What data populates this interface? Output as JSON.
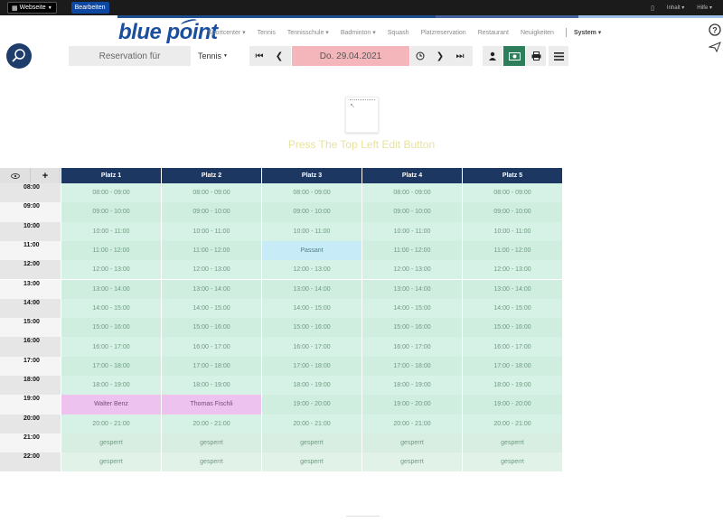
{
  "adminbar": {
    "website_label": "Webseite",
    "edit_label": "Bearbeiten",
    "content_label": "Inhalt",
    "help_label": "Hilfe"
  },
  "progress_colors": [
    "#1f4e8c",
    "#43649c",
    "#9bc2e6"
  ],
  "brand": {
    "logo_text": "blue point",
    "color": "#1a4f9e"
  },
  "nav": {
    "items": [
      {
        "label": "Sportcenter",
        "dropdown": true
      },
      {
        "label": "Tennis",
        "dropdown": false
      },
      {
        "label": "Tennisschule",
        "dropdown": true
      },
      {
        "label": "Badminton",
        "dropdown": true
      },
      {
        "label": "Squash",
        "dropdown": false
      },
      {
        "label": "Platzreservation",
        "dropdown": false
      },
      {
        "label": "Restaurant",
        "dropdown": false
      },
      {
        "label": "Neuigkeiten",
        "dropdown": false
      }
    ],
    "system_label": "System"
  },
  "toolbar": {
    "reservation_label": "Reservation für",
    "sport_select": "Tennis",
    "date": "Do. 29.04.2021"
  },
  "edit_hint": "Press The Top Left Edit Button",
  "grid": {
    "courts": [
      "Platz 1",
      "Platz 2",
      "Platz 3",
      "Platz 4",
      "Platz 5"
    ],
    "times": [
      "08:00",
      "09:00",
      "10:00",
      "11:00",
      "12:00",
      "13:00",
      "14:00",
      "15:00",
      "16:00",
      "17:00",
      "18:00",
      "19:00",
      "20:00",
      "21:00",
      "22:00"
    ],
    "rows": [
      [
        "08:00 - 09:00",
        "08:00 - 09:00",
        "08:00 - 09:00",
        "08:00 - 09:00",
        "08:00 - 09:00"
      ],
      [
        "09:00 - 10:00",
        "09:00 - 10:00",
        "09:00 - 10:00",
        "09:00 - 10:00",
        "09:00 - 10:00"
      ],
      [
        "10:00 - 11:00",
        "10:00 - 11:00",
        "10:00 - 11:00",
        "10:00 - 11:00",
        "10:00 - 11:00"
      ],
      [
        "11:00 - 12:00",
        "11:00 - 12:00",
        "Passant",
        "11:00 - 12:00",
        "11:00 - 12:00"
      ],
      [
        "12:00 - 13:00",
        "12:00 - 13:00",
        "12:00 - 13:00",
        "12:00 - 13:00",
        "12:00 - 13:00"
      ],
      [
        "13:00 - 14:00",
        "13:00 - 14:00",
        "13:00 - 14:00",
        "13:00 - 14:00",
        "13:00 - 14:00"
      ],
      [
        "14:00 - 15:00",
        "14:00 - 15:00",
        "14:00 - 15:00",
        "14:00 - 15:00",
        "14:00 - 15:00"
      ],
      [
        "15:00 - 16:00",
        "15:00 - 16:00",
        "15:00 - 16:00",
        "15:00 - 16:00",
        "15:00 - 16:00"
      ],
      [
        "16:00 - 17:00",
        "16:00 - 17:00",
        "16:00 - 17:00",
        "16:00 - 17:00",
        "16:00 - 17:00"
      ],
      [
        "17:00 - 18:00",
        "17:00 - 18:00",
        "17:00 - 18:00",
        "17:00 - 18:00",
        "17:00 - 18:00"
      ],
      [
        "18:00 - 19:00",
        "18:00 - 19:00",
        "18:00 - 19:00",
        "18:00 - 19:00",
        "18:00 - 19:00"
      ],
      [
        "Walter Benz",
        "Thomas Fischli",
        "19:00 - 20:00",
        "19:00 - 20:00",
        "19:00 - 20:00"
      ],
      [
        "20:00 - 21:00",
        "20:00 - 21:00",
        "20:00 - 21:00",
        "20:00 - 21:00",
        "20:00 - 21:00"
      ],
      [
        "gesperrt",
        "gesperrt",
        "gesperrt",
        "gesperrt",
        "gesperrt"
      ],
      [
        "gesperrt",
        "gesperrt",
        "gesperrt",
        "gesperrt",
        "gesperrt"
      ]
    ],
    "status": [
      [
        "free",
        "free",
        "free",
        "free",
        "free"
      ],
      [
        "free",
        "free",
        "free",
        "free",
        "free"
      ],
      [
        "free",
        "free",
        "free",
        "free",
        "free"
      ],
      [
        "free",
        "free",
        "guest",
        "free",
        "free"
      ],
      [
        "free",
        "free",
        "free",
        "free",
        "free"
      ],
      [
        "free",
        "free",
        "free",
        "free",
        "free"
      ],
      [
        "free",
        "free",
        "free",
        "free",
        "free"
      ],
      [
        "free",
        "free",
        "free",
        "free",
        "free"
      ],
      [
        "free",
        "free",
        "free",
        "free",
        "free"
      ],
      [
        "free",
        "free",
        "free",
        "free",
        "free"
      ],
      [
        "free",
        "free",
        "free",
        "free",
        "free"
      ],
      [
        "booked",
        "booked",
        "free",
        "free",
        "free"
      ],
      [
        "free",
        "free",
        "free",
        "free",
        "free"
      ],
      [
        "blocked",
        "blocked",
        "blocked",
        "blocked",
        "blocked"
      ],
      [
        "blocked",
        "blocked",
        "blocked",
        "blocked",
        "blocked"
      ]
    ]
  },
  "colors": {
    "free": "#cfeee0",
    "free_alt": "#d6f1e5",
    "booked": "#eec2ef",
    "guest": "#c8ecf7",
    "blocked": "#dcefe4",
    "court_header": "#1c3762"
  },
  "icons": [
    "eye-icon",
    "plus-icon",
    "first-icon",
    "prev-icon",
    "next-icon",
    "last-icon",
    "clock-icon",
    "user-icon",
    "money-icon",
    "print-icon",
    "list-icon",
    "help-icon",
    "send-icon",
    "racket-icon"
  ]
}
